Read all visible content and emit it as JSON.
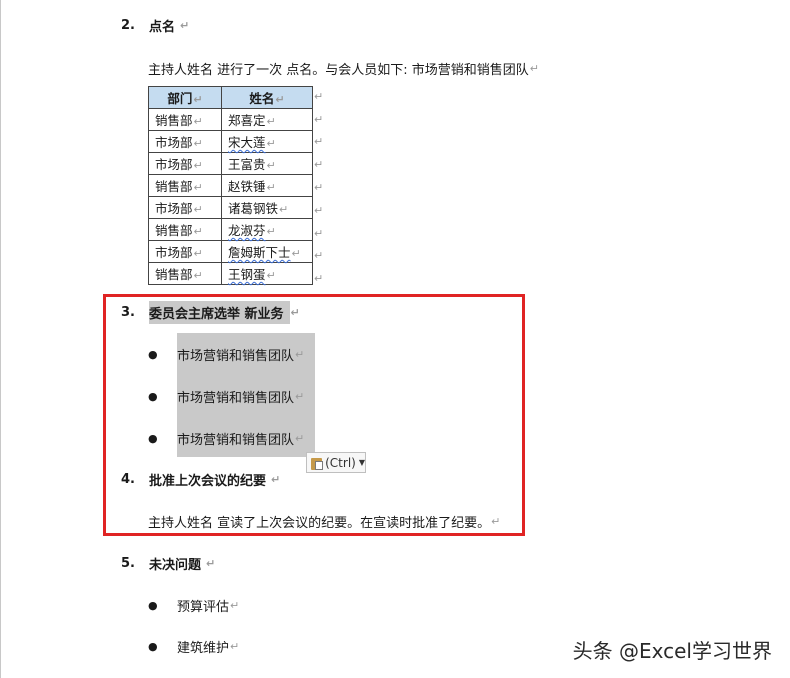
{
  "section2": {
    "num": "2.",
    "title": "点名",
    "intro": "主持人姓名  进行了一次  点名。与会人员如下: 市场营销和销售团队",
    "table": {
      "headers": [
        "部门",
        "姓名"
      ],
      "rows": [
        [
          "销售部",
          "郑喜定"
        ],
        [
          "市场部",
          "宋大莲"
        ],
        [
          "市场部",
          "王富贵"
        ],
        [
          "销售部",
          "赵铁锤"
        ],
        [
          "市场部",
          "诸葛钢铁"
        ],
        [
          "销售部",
          "龙淑芬"
        ],
        [
          "市场部",
          "詹姆斯下士"
        ],
        [
          "销售部",
          "王钢蛋"
        ]
      ]
    }
  },
  "section3": {
    "num": "3.",
    "title": "委员会主席选举  新业务",
    "bullets": [
      "市场营销和销售团队",
      "市场营销和销售团队",
      "市场营销和销售团队"
    ]
  },
  "paste_options": {
    "label": "(Ctrl)"
  },
  "section4": {
    "num": "4.",
    "title": "批准上次会议的纪要",
    "body": "主持人姓名  宣读了上次会议的纪要。在宣读时批准了纪要。"
  },
  "section5": {
    "num": "5.",
    "title": "未决问题",
    "bullets": [
      "预算评估",
      "建筑维护"
    ]
  },
  "watermark": "头条 @Excel学习世界",
  "paragraph_mark": "↵",
  "colors": {
    "highlight_box": "#e02323",
    "table_header": "#c5dcf0",
    "selection": "#c9c9c9"
  }
}
